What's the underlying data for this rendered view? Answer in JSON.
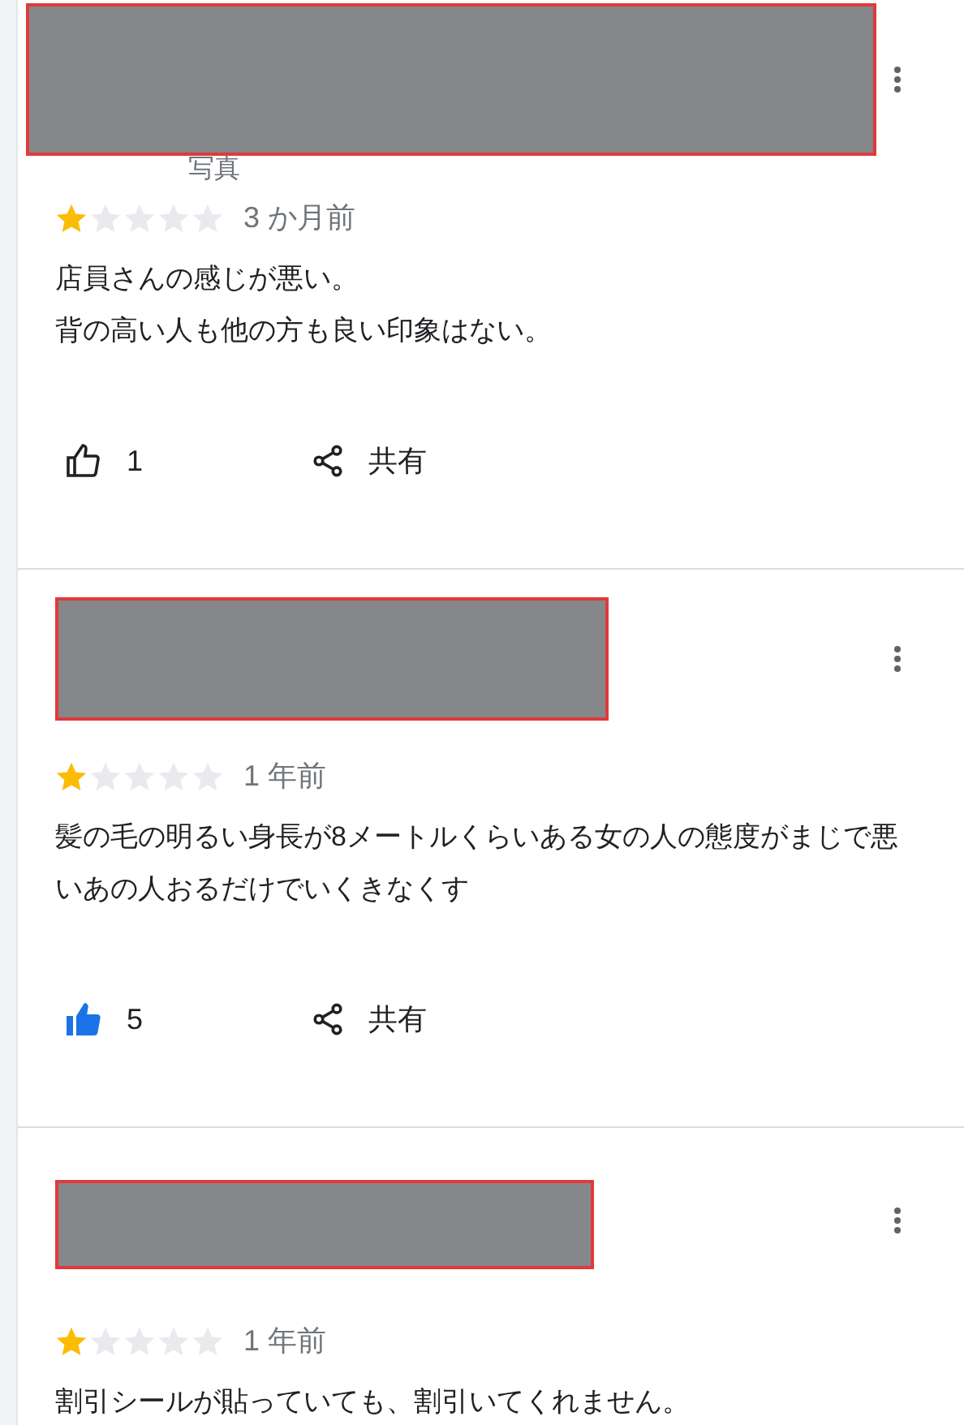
{
  "reviews": [
    {
      "peek_text": "写真",
      "stars": 1,
      "time": "3 か月前",
      "text": [
        "店員さんの感じが悪い。",
        "背の高い人も他の方も良い印象はない。"
      ],
      "liked": false,
      "like_count": "1",
      "share_label": "共有"
    },
    {
      "stars": 1,
      "time": "1 年前",
      "text": [
        "髪の毛の明るい身長が8メートルくらいある女の人の態度がまじで悪いあの人おるだけでいくきなくす"
      ],
      "liked": true,
      "like_count": "5",
      "share_label": "共有"
    },
    {
      "stars": 1,
      "time": "1 年前",
      "text": [
        "割引シールが貼っていても、割引いてくれません。"
      ]
    }
  ]
}
